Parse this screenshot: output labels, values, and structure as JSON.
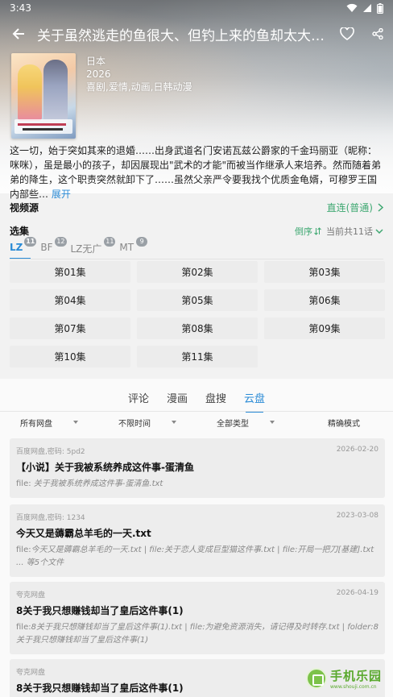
{
  "status_bar": {
    "time": "3:43"
  },
  "app_bar": {
    "title": "关于虽然逃走的鱼很大、但钓上来的鱼却太大了的那件事",
    "icons": [
      "arrow-back-icon",
      "heart-outline-icon",
      "share-icon"
    ]
  },
  "info": {
    "region": "日本",
    "year": "2026",
    "genres": "喜剧,爱情,动画,日韩动漫"
  },
  "description": {
    "text": "这一切，始于突如其来的退婚……出身武道名门安诺瓦兹公爵家的千金玛丽亚（昵称：咪咪），虽是最小的孩子，却因展现出\"武术的才能\"而被当作继承人来培养。然而随着弟弟的降生，这个职责突然就卸下了……虽然父亲严令要我找个优质金龟婿，可穆罗王国内部些…",
    "expand_label": "展开"
  },
  "source": {
    "label": "视频源",
    "value": "直连(普通)"
  },
  "episodes": {
    "label": "选集",
    "order_label": "倒序",
    "count_label": "当前共11话",
    "tabs": [
      {
        "label": "LZ",
        "badge": "11",
        "active": true
      },
      {
        "label": "BF",
        "badge": "12",
        "active": false
      },
      {
        "label": "LZ无广",
        "badge": "11",
        "active": false
      },
      {
        "label": "MT",
        "badge": "9",
        "active": false
      }
    ],
    "items": [
      "第01集",
      "第02集",
      "第03集",
      "第04集",
      "第05集",
      "第06集",
      "第07集",
      "第08集",
      "第09集",
      "第10集",
      "第11集"
    ]
  },
  "main_tabs": [
    {
      "label": "评论",
      "active": false
    },
    {
      "label": "漫画",
      "active": false
    },
    {
      "label": "盘搜",
      "active": false
    },
    {
      "label": "云盘",
      "active": true
    }
  ],
  "filters": [
    {
      "label": "所有网盘",
      "has_dropdown": true
    },
    {
      "label": "不限时间",
      "has_dropdown": true
    },
    {
      "label": "全部类型",
      "has_dropdown": true
    },
    {
      "label": "精确模式",
      "has_dropdown": false
    }
  ],
  "results": [
    {
      "source": "百度网盘,密码: 5pd2",
      "date": "2026-02-20",
      "title": "【小说】关于我被系统养成这件事-蛋清鱼",
      "file_prefix": "file: ",
      "file_text": "关于我被系统养成这件事-蛋清鱼.txt"
    },
    {
      "source": "百度网盘,密码: 1234",
      "date": "2023-03-08",
      "title": "今天又是薅霸总羊毛的一天.txt",
      "file_prefix": "file:",
      "file_text": "今天又是薅霸总羊毛的一天.txt | file:关于恋人变成巨型猫这件事.txt | file:开局一把刀[基建].txt ... 等5个文件"
    },
    {
      "source": "夸克网盘",
      "date": "2026-04-19",
      "title": "8关于我只想赚钱却当了皇后这件事(1)",
      "file_prefix": "file:",
      "file_text": "8关于我只想赚钱却当了皇后这件事(1).txt | file:为避免资源消失，请记得及时转存.txt | folder:8关于我只想赚钱却当了皇后这件事(1)"
    },
    {
      "source": "夸克网盘",
      "date": "",
      "title": "8关于我只想赚钱却当了皇后这件事(1)",
      "file_prefix": "",
      "file_text": ""
    }
  ],
  "watermark": {
    "cn": "手机乐园",
    "en": "www.shouji.com.cn"
  },
  "colors": {
    "accent": "#2a8bd6",
    "green": "#3fa872"
  }
}
